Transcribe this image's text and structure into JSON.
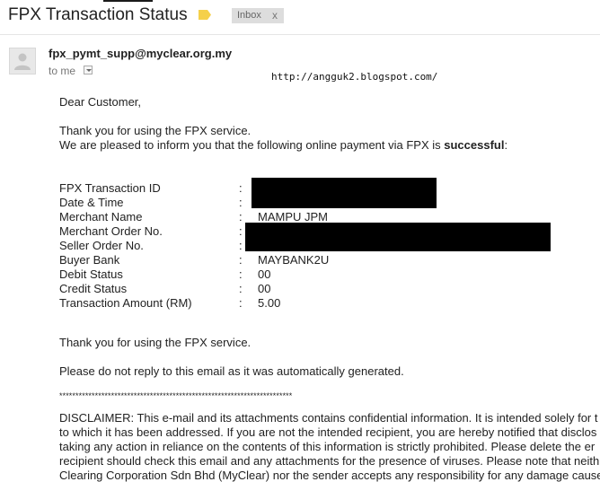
{
  "header": {
    "subject": "FPX Transaction Status",
    "label_chip": "Inbox",
    "label_chip_close": "x"
  },
  "message": {
    "sender": "fpx_pymt_supp@myclear.org.my",
    "to": "to me",
    "watermark": "http://angguk2.blogspot.com/",
    "greeting": "Dear Customer,",
    "intro_line1": "Thank you for using the FPX service.",
    "intro_line2_prefix": "We are pleased to inform you that the following online payment via FPX is ",
    "intro_line2_bold": "successful",
    "intro_line2_suffix": ":",
    "details": [
      {
        "label": "FPX Transaction ID",
        "colon": ":",
        "value": ""
      },
      {
        "label": "Date & Time",
        "colon": ":",
        "value": ""
      },
      {
        "label": "Merchant Name",
        "colon": ":",
        "value": "MAMPU JPM"
      },
      {
        "label": "Merchant Order No.",
        "colon": ":",
        "value": ""
      },
      {
        "label": "Seller Order No.",
        "colon": ":",
        "value": ""
      },
      {
        "label": "Buyer Bank",
        "colon": ":",
        "value": "MAYBANK2U"
      },
      {
        "label": "Debit Status",
        "colon": ":",
        "value": "00"
      },
      {
        "label": "Credit Status",
        "colon": ":",
        "value": "00"
      },
      {
        "label": "Transaction Amount (RM)",
        "colon": ":",
        "value": "5.00"
      }
    ],
    "thanks": "Thank you for using the FPX service.",
    "no_reply": "Please do not reply to this email as it was automatically generated.",
    "separator": "************************************************************************",
    "disclaimer_lines": [
      "DISCLAIMER: This e-mail and its attachments contains confidential information. It is intended solely for t",
      "to which it has been addressed. If you are not the intended recipient, you are hereby notified that disclos",
      "taking any action in reliance on the contents of this information is strictly prohibited. Please delete the er",
      "recipient should check this email and any attachments for the presence of viruses. Please note that neith",
      "Clearing Corporation Sdn Bhd (MyClear) nor the sender accepts any responsibility for any damage cause"
    ]
  },
  "colors": {
    "label_tag": "#f5d04a",
    "chip_bg": "#dddddd",
    "redaction": "#000000"
  }
}
